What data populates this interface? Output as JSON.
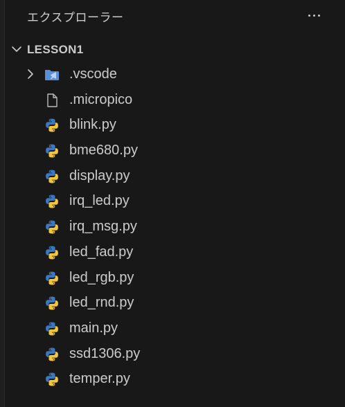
{
  "explorer": {
    "title": "エクスプローラー",
    "more_icon": "ellipsis-icon"
  },
  "folder": {
    "name": "LESSON1",
    "expanded": true
  },
  "items": [
    {
      "label": ".vscode",
      "type": "folder",
      "icon": "vscode-folder-icon",
      "expanded": false
    },
    {
      "label": ".micropico",
      "type": "file",
      "icon": "file-icon"
    },
    {
      "label": "blink.py",
      "type": "file",
      "icon": "python-icon"
    },
    {
      "label": "bme680.py",
      "type": "file",
      "icon": "python-icon"
    },
    {
      "label": "display.py",
      "type": "file",
      "icon": "python-icon"
    },
    {
      "label": "irq_led.py",
      "type": "file",
      "icon": "python-icon"
    },
    {
      "label": "irq_msg.py",
      "type": "file",
      "icon": "python-icon"
    },
    {
      "label": "led_fad.py",
      "type": "file",
      "icon": "python-icon"
    },
    {
      "label": "led_rgb.py",
      "type": "file",
      "icon": "python-icon"
    },
    {
      "label": "led_rnd.py",
      "type": "file",
      "icon": "python-icon"
    },
    {
      "label": "main.py",
      "type": "file",
      "icon": "python-icon"
    },
    {
      "label": "ssd1306.py",
      "type": "file",
      "icon": "python-icon"
    },
    {
      "label": "temper.py",
      "type": "file",
      "icon": "python-icon"
    }
  ],
  "colors": {
    "background": "#181818",
    "text": "#cccccc",
    "python_blue": "#3b78c2",
    "python_yellow": "#f2c53d",
    "vscode_folder": "#5a8fd8"
  }
}
